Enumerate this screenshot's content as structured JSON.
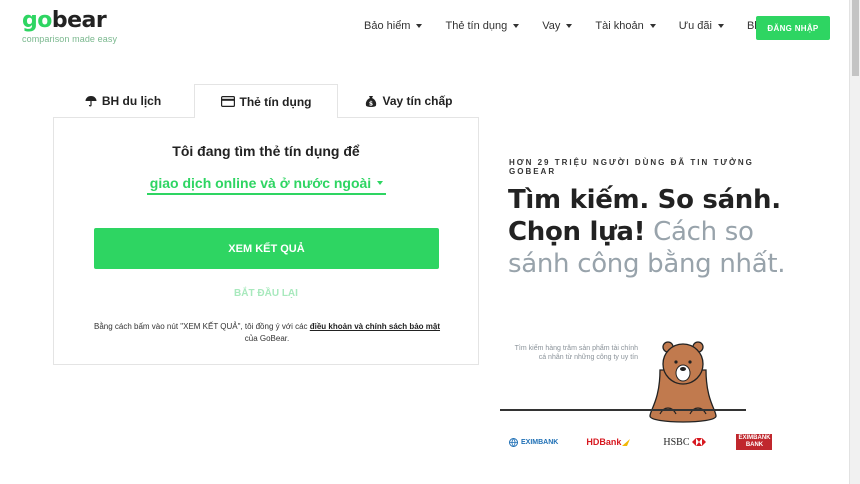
{
  "brand": {
    "name_prefix": "go",
    "name_suffix": "bear",
    "tagline": "comparison made easy",
    "accent": "#2ed562"
  },
  "nav": {
    "items": [
      {
        "label": "Bảo hiểm",
        "dropdown": true
      },
      {
        "label": "Thẻ tín dụng",
        "dropdown": true
      },
      {
        "label": "Vay",
        "dropdown": true
      },
      {
        "label": "Tài khoản",
        "dropdown": true
      },
      {
        "label": "Ưu đãi",
        "dropdown": true
      },
      {
        "label": "Blog",
        "dropdown": false
      }
    ],
    "login_label": "ĐĂNG NHẬP"
  },
  "tabs": [
    {
      "label": "BH du lịch",
      "icon": "umbrella-icon",
      "active": false
    },
    {
      "label": "Thẻ tín dụng",
      "icon": "credit-card-icon",
      "active": true
    },
    {
      "label": "Vay tín chấp",
      "icon": "money-bag-icon",
      "active": false
    }
  ],
  "search": {
    "title": "Tôi đang tìm thẻ tín dụng để",
    "purpose_value": "giao dịch online và ở nước ngoài",
    "results_label": "XEM KẾT QUẢ",
    "restart_label": "BẮT ĐẦU LẠI",
    "disclaimer_pre": "Bằng cách bấm vào nút \"XEM KẾT QUẢ\", tôi đồng ý với các ",
    "disclaimer_link": "điều khoản và chính sách bảo mật",
    "disclaimer_post": " của GoBear."
  },
  "hero": {
    "kicker": "HƠN 29 TRIỆU NGƯỜI DÙNG ĐÃ TIN TƯỞNG GOBEAR",
    "headline_bold": "Tìm kiếm. So sánh. Chọn lựa!",
    "headline_light": " Cách so sánh công bằng nhất.",
    "bear_caption": "Tìm kiếm hàng trăm sản phẩm tài chính cá nhân từ những công ty uy tín"
  },
  "banks": [
    {
      "name": "EXIMBANK"
    },
    {
      "name": "HDBank"
    },
    {
      "name": "HSBC"
    },
    {
      "name": "EXIMBANK BANK"
    }
  ]
}
